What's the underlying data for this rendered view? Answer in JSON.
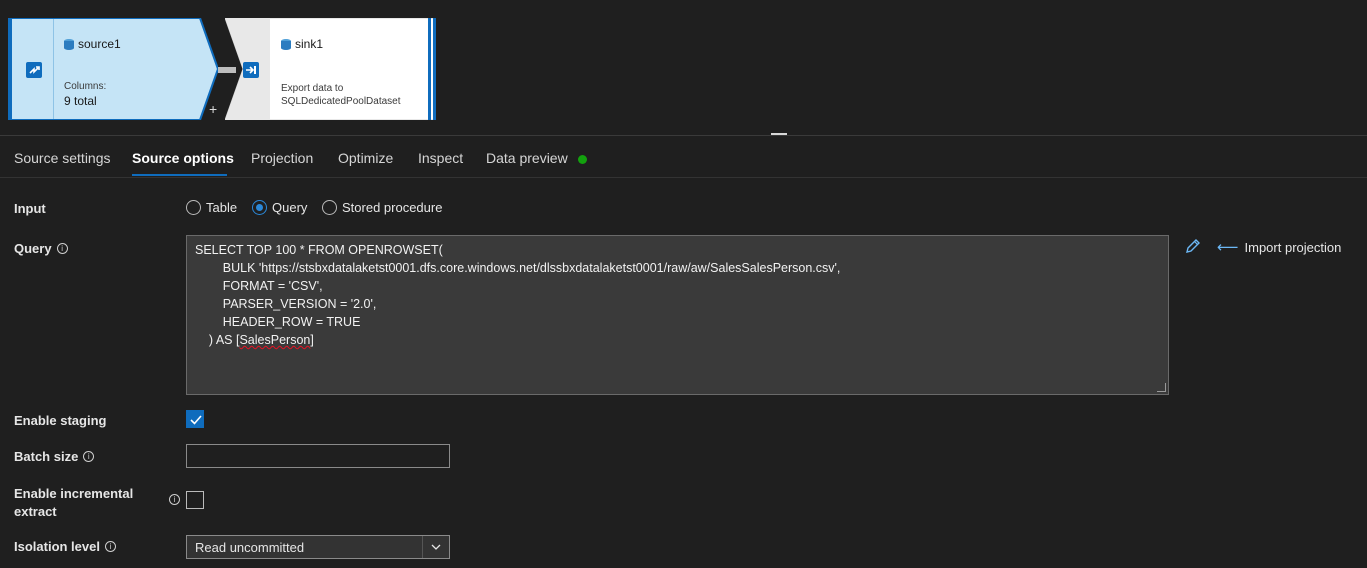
{
  "pipeline": {
    "source": {
      "title": "source1",
      "sub_label": "Columns:",
      "count": "9 total"
    },
    "sink": {
      "title": "sink1",
      "desc_line1": "Export data to",
      "desc_line2": "SQLDedicatedPoolDataset"
    },
    "add_symbol": "+"
  },
  "tabs": [
    {
      "label": "Source settings"
    },
    {
      "label": "Source options"
    },
    {
      "label": "Projection"
    },
    {
      "label": "Optimize"
    },
    {
      "label": "Inspect"
    },
    {
      "label": "Data preview"
    }
  ],
  "active_tab": "Source options",
  "data_preview_status_color": "#13a10e",
  "form": {
    "input": {
      "label": "Input",
      "options": [
        "Table",
        "Query",
        "Stored procedure"
      ],
      "selected": "Query"
    },
    "query": {
      "label": "Query",
      "lines": [
        "SELECT TOP 100 * FROM OPENROWSET(",
        "        BULK 'https://stsbxdatalaketst0001.dfs.core.windows.net/dlssbxdatalaketst0001/raw/aw/SalesSalesPerson.csv',",
        "        FORMAT = 'CSV',",
        "        PARSER_VERSION = '2.0',",
        "        HEADER_ROW = TRUE",
        "    ) AS [",
        "SalesPerson",
        "]"
      ],
      "import_label": "Import projection"
    },
    "enable_staging": {
      "label": "Enable staging",
      "checked": true
    },
    "batch_size": {
      "label": "Batch size",
      "value": ""
    },
    "incremental": {
      "label_line1": "Enable incremental",
      "label_line2": "extract",
      "checked": false
    },
    "isolation": {
      "label": "Isolation level",
      "value": "Read uncommitted"
    }
  },
  "info_glyph": "i",
  "accent_color": "#0f6cbd"
}
